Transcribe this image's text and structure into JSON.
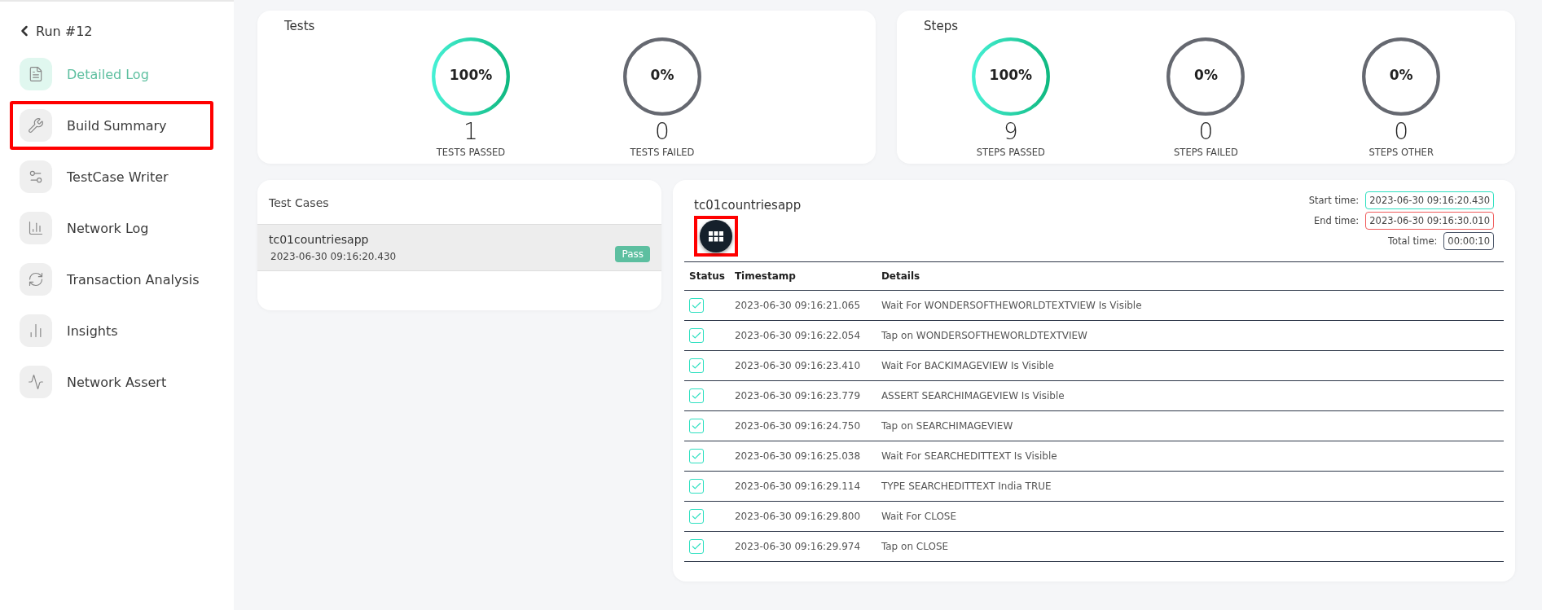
{
  "back": {
    "label": "Run #12"
  },
  "sidebar": {
    "items": [
      {
        "label": "Detailed Log",
        "selected": true,
        "highlighted": false
      },
      {
        "label": "Build Summary",
        "selected": false,
        "highlighted": true
      },
      {
        "label": "TestCase Writer",
        "selected": false,
        "highlighted": false
      },
      {
        "label": "Network Log",
        "selected": false,
        "highlighted": false
      },
      {
        "label": "Transaction Analysis",
        "selected": false,
        "highlighted": false
      },
      {
        "label": "Insights",
        "selected": false,
        "highlighted": false
      },
      {
        "label": "Network Assert",
        "selected": false,
        "highlighted": false
      }
    ]
  },
  "summary_cards": [
    {
      "title": "Tests",
      "gauges": [
        {
          "percent": "100%",
          "count": "1",
          "label": "TESTS PASSED",
          "kind": "pass"
        },
        {
          "percent": "0%",
          "count": "0",
          "label": "TESTS FAILED",
          "kind": "neutral"
        }
      ]
    },
    {
      "title": "Steps",
      "gauges": [
        {
          "percent": "100%",
          "count": "9",
          "label": "STEPS PASSED",
          "kind": "pass"
        },
        {
          "percent": "0%",
          "count": "0",
          "label": "STEPS FAILED",
          "kind": "neutral"
        },
        {
          "percent": "0%",
          "count": "0",
          "label": "STEPS OTHER",
          "kind": "neutral"
        }
      ]
    }
  ],
  "test_cases": {
    "title": "Test Cases",
    "items": [
      {
        "name": "tc01countriesapp",
        "time": "2023-06-30 09:16:20.430",
        "status": "Pass",
        "selected": true
      }
    ]
  },
  "detail": {
    "title": "tc01countriesapp",
    "grid_button": {
      "highlighted": true
    },
    "times": [
      {
        "label": "Start time:",
        "value": "2023-06-30 09:16:20.430",
        "color": "#2ee0c0"
      },
      {
        "label": "End time:",
        "value": "2023-06-30 09:16:30.010",
        "color": "#f05a5a"
      },
      {
        "label": "Total time:",
        "value": "00:00:10",
        "color": "#4a5568"
      }
    ],
    "columns": [
      "Status",
      "Timestamp",
      "Details"
    ],
    "rows": [
      {
        "checked": true,
        "timestamp": "2023-06-30 09:16:21.065",
        "details": "Wait For WONDERSOFTHEWORLDTEXTVIEW Is Visible"
      },
      {
        "checked": true,
        "timestamp": "2023-06-30 09:16:22.054",
        "details": "Tap on WONDERSOFTHEWORLDTEXTVIEW"
      },
      {
        "checked": true,
        "timestamp": "2023-06-30 09:16:23.410",
        "details": "Wait For BACKIMAGEVIEW Is Visible"
      },
      {
        "checked": true,
        "timestamp": "2023-06-30 09:16:23.779",
        "details": "ASSERT SEARCHIMAGEVIEW Is Visible"
      },
      {
        "checked": true,
        "timestamp": "2023-06-30 09:16:24.750",
        "details": "Tap on SEARCHIMAGEVIEW"
      },
      {
        "checked": true,
        "timestamp": "2023-06-30 09:16:25.038",
        "details": "Wait For SEARCHEDITTEXT Is Visible"
      },
      {
        "checked": true,
        "timestamp": "2023-06-30 09:16:29.114",
        "details": "TYPE SEARCHEDITTEXT India TRUE"
      },
      {
        "checked": true,
        "timestamp": "2023-06-30 09:16:29.800",
        "details": "Wait For CLOSE"
      },
      {
        "checked": true,
        "timestamp": "2023-06-30 09:16:29.974",
        "details": "Tap on CLOSE"
      }
    ]
  }
}
